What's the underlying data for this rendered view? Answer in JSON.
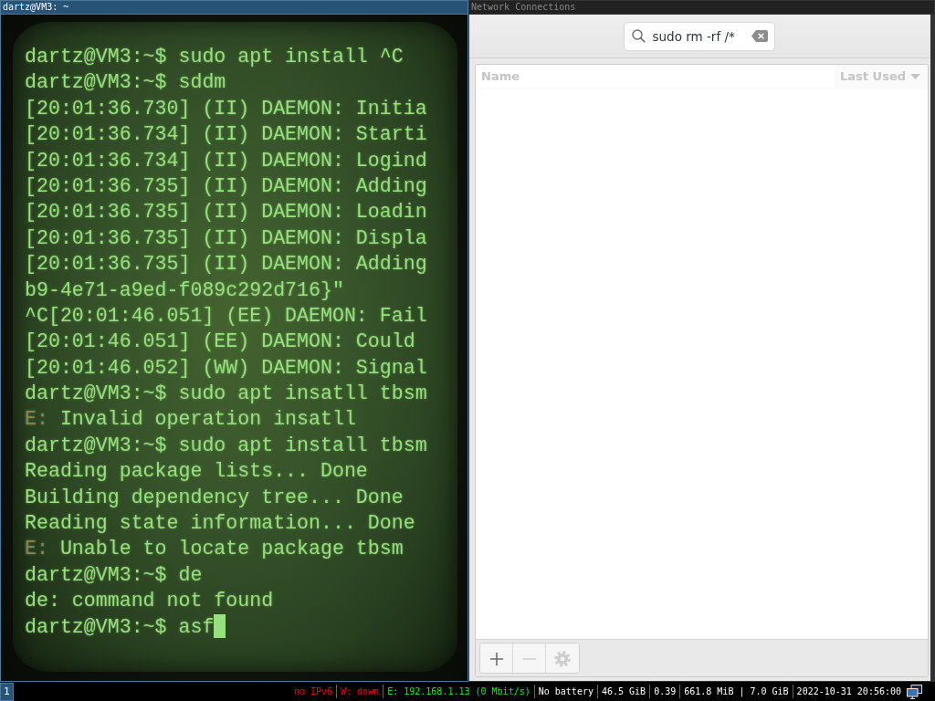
{
  "terminal_window": {
    "title": "dartz@VM3: ~",
    "focused": true,
    "cursor_visible": true,
    "lines": [
      {
        "text": "dartz@VM3:~$ sudo apt install ^C"
      },
      {
        "text": "dartz@VM3:~$ sddm"
      },
      {
        "text": "[20:01:36.730] (II) DAEMON: Initia"
      },
      {
        "text": "[20:01:36.734] (II) DAEMON: Starti"
      },
      {
        "text": "[20:01:36.734] (II) DAEMON: Logind"
      },
      {
        "text": "[20:01:36.735] (II) DAEMON: Adding"
      },
      {
        "text": "[20:01:36.735] (II) DAEMON: Loadin"
      },
      {
        "text": "[20:01:36.735] (II) DAEMON: Displa"
      },
      {
        "text": "[20:01:36.735] (II) DAEMON: Adding"
      },
      {
        "text": "b9-4e71-a9ed-f089c292d716}\""
      },
      {
        "text": "^C[20:01:46.051] (EE) DAEMON: Fail"
      },
      {
        "text": "[20:01:46.051] (EE) DAEMON: Could"
      },
      {
        "text": "[20:01:46.052] (WW) DAEMON: Signal"
      },
      {
        "text": "dartz@VM3:~$ sudo apt insatll tbsm"
      },
      {
        "prefix": "E:",
        "text": "Invalid operation insatll"
      },
      {
        "text": "dartz@VM3:~$ sudo apt install tbsm"
      },
      {
        "text": "Reading package lists... Done"
      },
      {
        "text": "Building dependency tree... Done"
      },
      {
        "text": "Reading state information... Done"
      },
      {
        "prefix": "E:",
        "text": "Unable to locate package tbsm"
      },
      {
        "text": "dartz@VM3:~$ de"
      },
      {
        "text": "de: command not found"
      },
      {
        "text": "dartz@VM3:~$ asf"
      }
    ]
  },
  "network_window": {
    "title": "Network Connections",
    "focused": false,
    "search": {
      "value": "sudo rm -rf /*"
    },
    "columns": [
      {
        "label": "Name",
        "sorted": false
      },
      {
        "label": "Last Used",
        "sorted": true
      }
    ],
    "toolbar": [
      {
        "kind": "add",
        "disabled": false
      },
      {
        "kind": "remove",
        "disabled": true
      },
      {
        "kind": "settings",
        "disabled": true
      }
    ]
  },
  "status_bar": {
    "workspaces": [
      {
        "label": "1",
        "focused": true
      }
    ],
    "items": [
      {
        "text": "no IPv6",
        "color": "#ff0000"
      },
      {
        "text": "W: down",
        "color": "#ff0000"
      },
      {
        "text": "E: 192.168.1.13 (0 Mbit/s)",
        "color": "#00ff00"
      },
      {
        "text": "No battery",
        "color": "#ffffff"
      },
      {
        "text": "46.5 GiB",
        "color": "#ffffff"
      },
      {
        "text": "0.39",
        "color": "#ffffff"
      },
      {
        "text": "661.8 MiB | 7.0 GiB",
        "color": "#ffffff"
      },
      {
        "text": "2022-10-31 20:56:00",
        "color": "#ffffff"
      }
    ]
  }
}
